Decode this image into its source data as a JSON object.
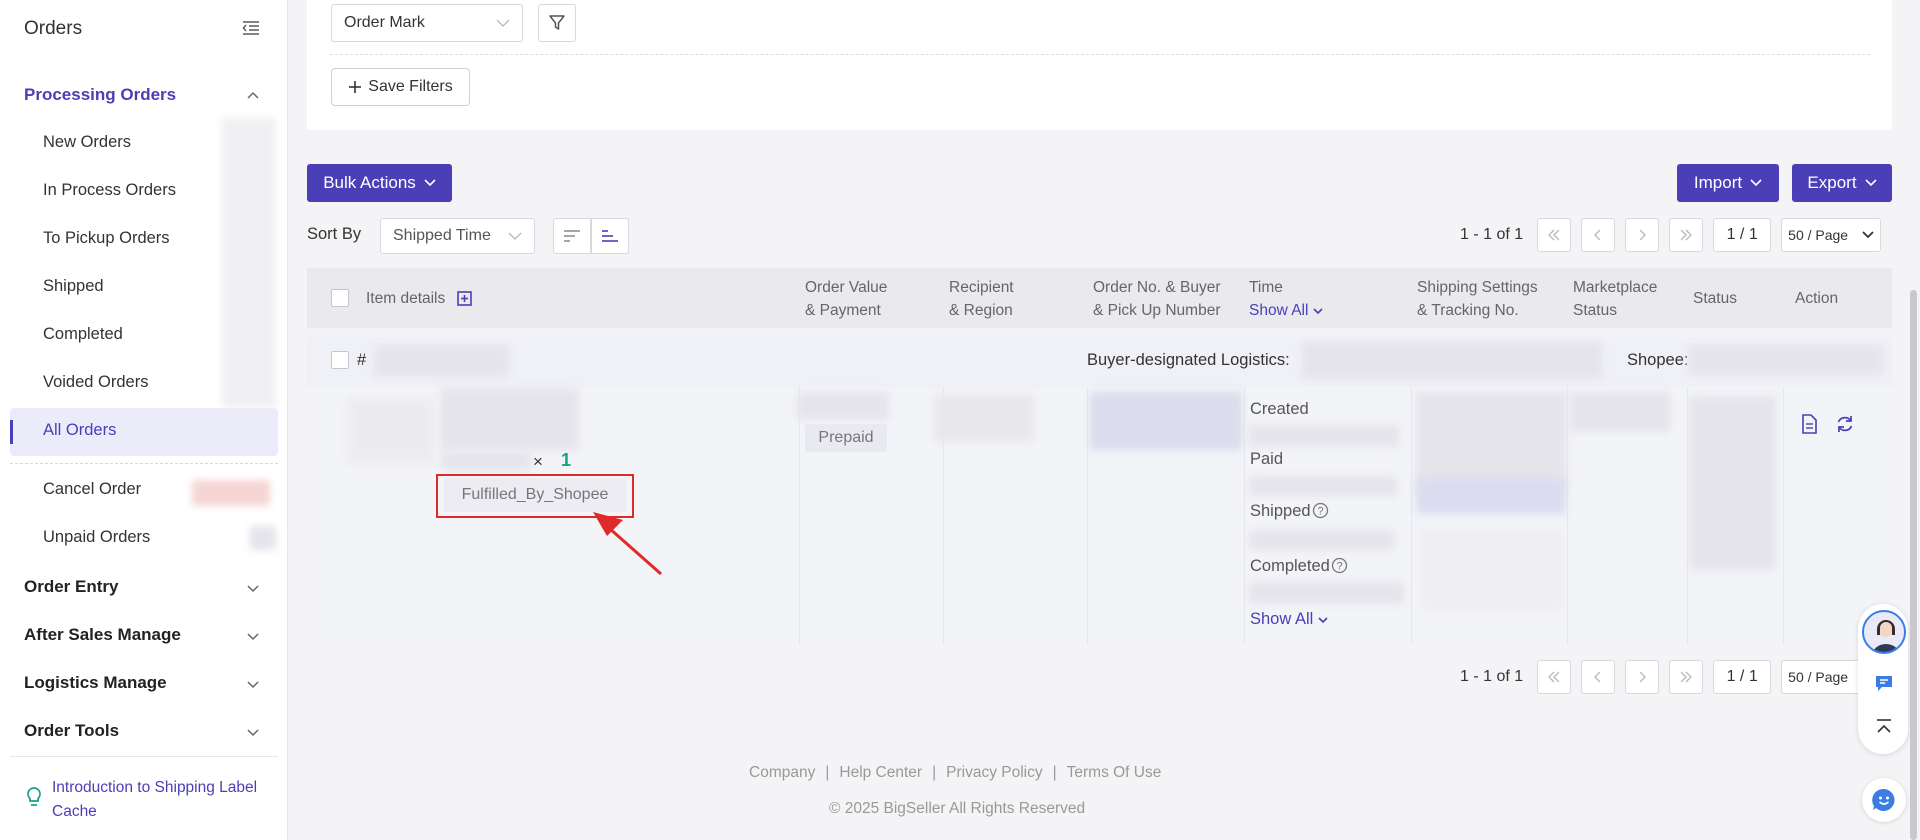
{
  "sidebar": {
    "title": "Orders",
    "groups": {
      "processing": "Processing Orders",
      "order_entry": "Order Entry",
      "after_sales": "After Sales Manage",
      "logistics": "Logistics Manage",
      "order_tools": "Order Tools"
    },
    "items": {
      "new": "New Orders",
      "in_process": "In Process Orders",
      "to_pickup": "To Pickup Orders",
      "shipped": "Shipped",
      "completed": "Completed",
      "voided": "Voided Orders",
      "all": "All Orders",
      "cancel": "Cancel Order",
      "unpaid": "Unpaid Orders"
    },
    "intro_link": "Introduction to Shipping Label Cache"
  },
  "filters": {
    "order_mark": "Order Mark",
    "save_filters": "Save Filters"
  },
  "toolbar": {
    "bulk_actions": "Bulk Actions",
    "import": "Import",
    "export": "Export",
    "sort_by_label": "Sort By",
    "sort_by_value": "Shipped Time"
  },
  "pagination": {
    "range": "1 - 1 of 1",
    "page": "1 / 1",
    "page_size": "50 / Page"
  },
  "table": {
    "headers": {
      "item_details": "Item details",
      "order_value_1": "Order Value",
      "order_value_2": "& Payment",
      "recipient_1": "Recipient",
      "recipient_2": "& Region",
      "order_no_1": "Order No. & Buyer",
      "order_no_2": "& Pick Up Number",
      "time": "Time",
      "time_show_all": "Show All",
      "shipping_1": "Shipping Settings",
      "shipping_2": "& Tracking No.",
      "marketplace_1": "Marketplace",
      "marketplace_2": "Status",
      "status": "Status",
      "action": "Action"
    },
    "row": {
      "hash": "#",
      "logistics_label": "Buyer-designated Logistics:",
      "shop_label": "Shopee:",
      "qty_x": "×",
      "qty": "1",
      "tag": "Fulfilled_By_Shopee",
      "payment": "Prepaid",
      "time_created": "Created",
      "time_paid": "Paid",
      "time_shipped": "Shipped",
      "time_completed": "Completed",
      "time_show_all": "Show All"
    }
  },
  "footer": {
    "links": [
      "Company",
      "Help Center",
      "Privacy Policy",
      "Terms Of Use"
    ],
    "separator": "|",
    "copyright": "© 2025 BigSeller All Rights Reserved"
  },
  "colors": {
    "accent": "#4a3fb6",
    "highlight_red": "#e02a2a",
    "qty_green": "#16a085"
  }
}
